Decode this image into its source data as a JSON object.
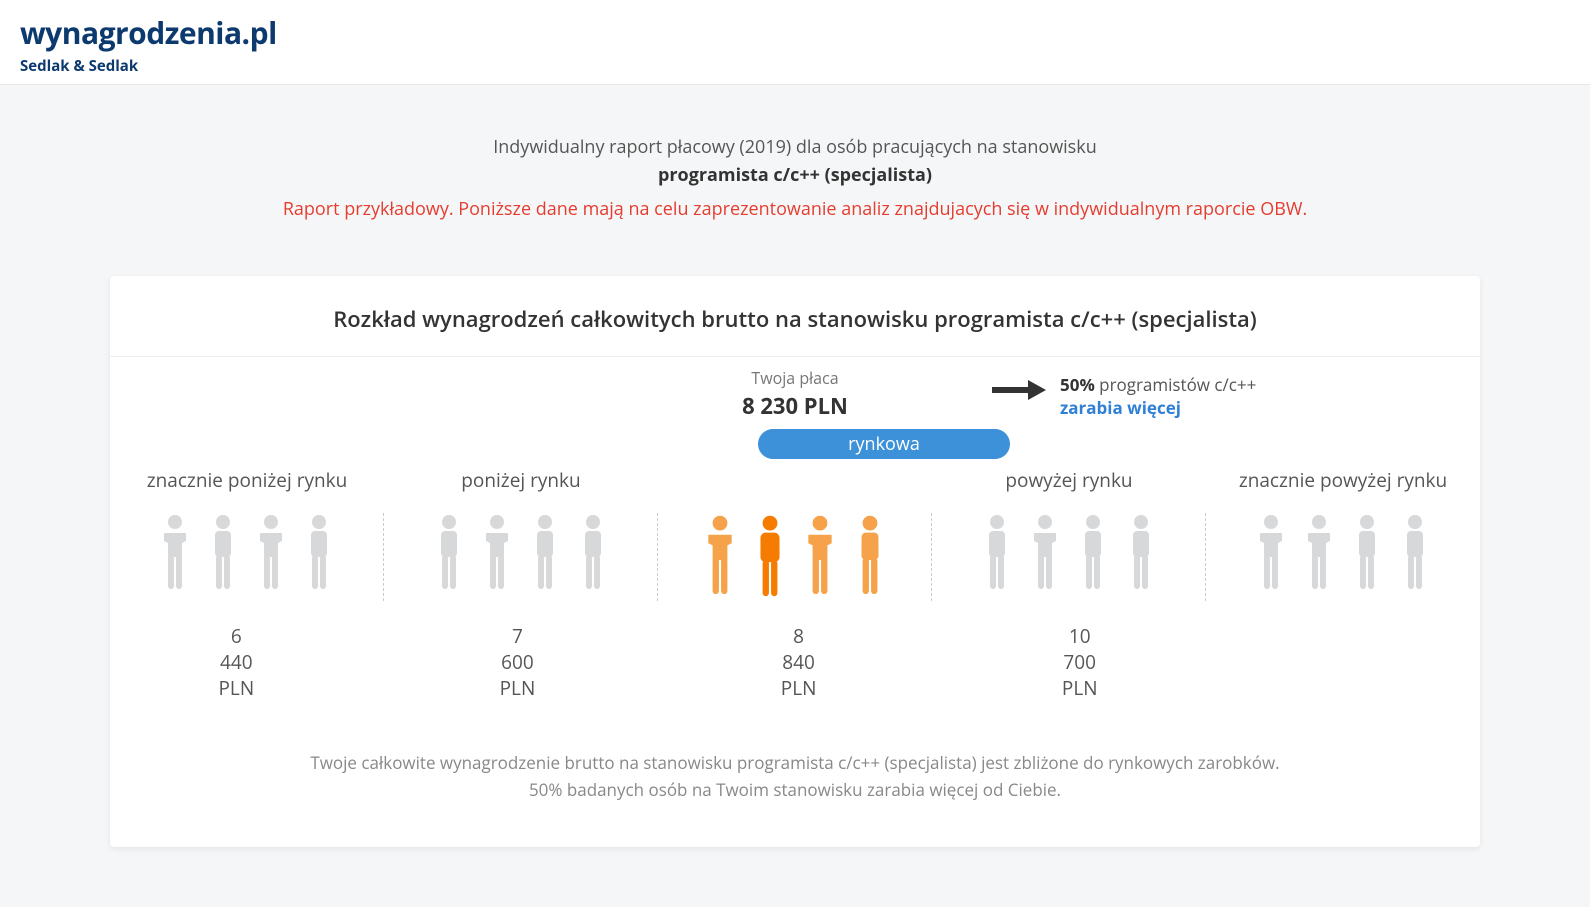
{
  "brand": {
    "name": "wynagrodzenia.pl",
    "sub": "Sedlak & Sedlak"
  },
  "intro": {
    "line1": "Indywidualny raport płacowy (2019) dla osób pracujących na stanowisku",
    "job": "programista c/c++ (specjalista)",
    "disclaimer": "Raport przykładowy. Poniższe dane mają na celu zaprezentowanie analiz znajdujacych się w indywidualnym raporcie OBW."
  },
  "card": {
    "title": "Rozkład wynagrodzeń całkowitych brutto na stanowisku programista c/c++ (specjalista)",
    "your_salary_label": "Twoja płaca",
    "your_salary_value": "8 230 PLN",
    "compare_pct": "50%",
    "compare_who": " programistów c/c++",
    "compare_more": "zarabia więcej",
    "pill": "rynkowa",
    "buckets": {
      "b1": "znacznie poniżej rynku",
      "b2": "poniżej rynku",
      "b3": "rynkowa",
      "b4": "powyżej rynku",
      "b5": "znacznie powyżej rynku"
    },
    "thresholds": {
      "t1": "6 440 PLN",
      "t2": "7 600 PLN",
      "t3": "8 840 PLN",
      "t4": "10 700 PLN"
    },
    "summary1": "Twoje całkowite wynagrodzenie brutto na stanowisku programista c/c++ (specjalista) jest zbliżone do rynkowych zarobków.",
    "summary2": "50% badanych osób na Twoim stanowisku zarabia więcej od Ciebie."
  },
  "chart_data": {
    "type": "bar",
    "title": "Rozkład wynagrodzeń całkowitych brutto na stanowisku programista c/c++ (specjalista)",
    "categories": [
      "znacznie poniżej rynku",
      "poniżej rynku",
      "rynkowa",
      "powyżej rynku",
      "znacznie powyżej rynku"
    ],
    "thresholds_pln": [
      6440,
      7600,
      8840,
      10700
    ],
    "user_salary_pln": 8230,
    "user_bucket": "rynkowa",
    "percent_earning_more": 50,
    "xlabel": "",
    "ylabel": "",
    "ylim": [
      0,
      12000
    ]
  }
}
